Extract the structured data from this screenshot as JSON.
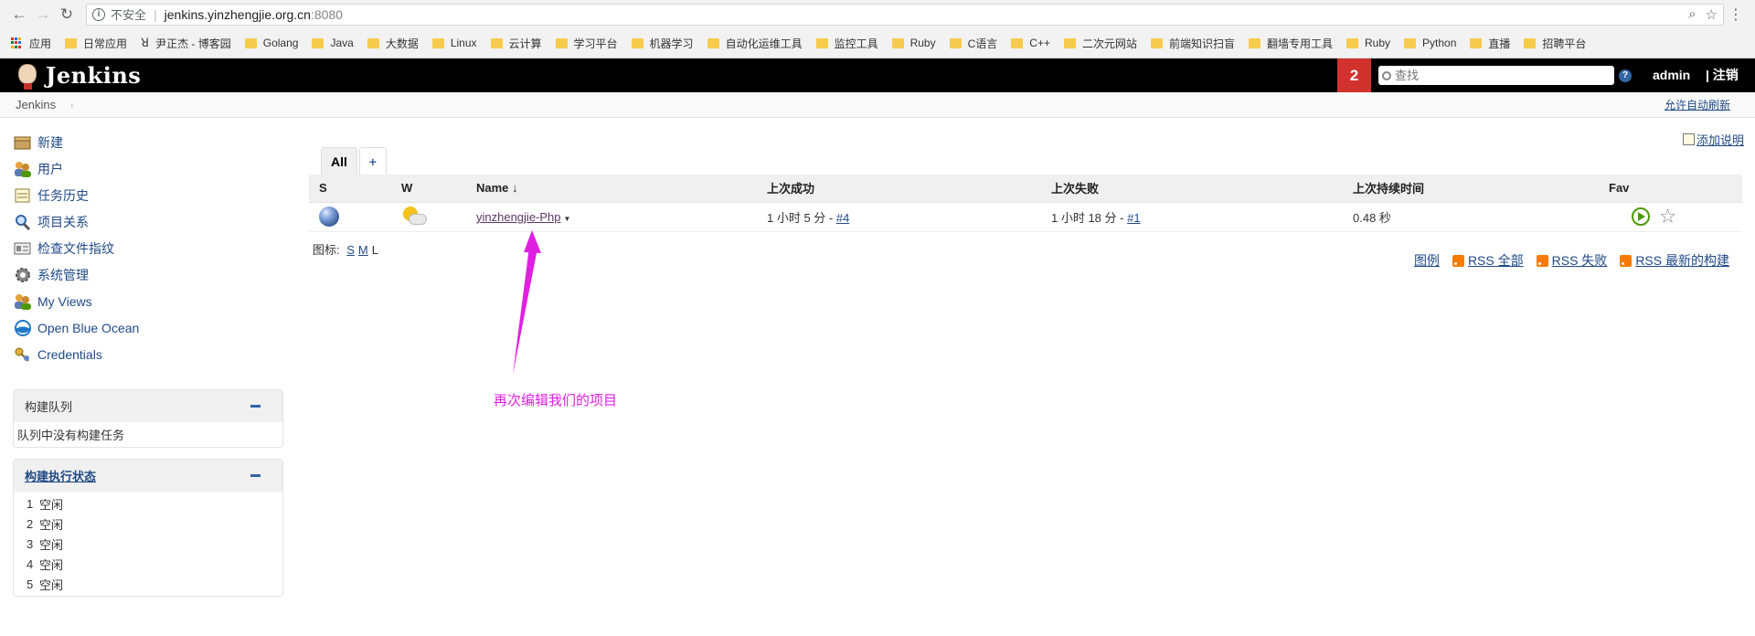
{
  "browser": {
    "insecure_label": "不安全",
    "host": "jenkins.yinzhengjie.org.cn",
    "port": ":8080",
    "bookmarks": [
      "应用",
      "日常应用",
      "尹正杰 - 博客园",
      "Golang",
      "Java",
      "大数据",
      "Linux",
      "云计算",
      "学习平台",
      "机器学习",
      "自动化运维工具",
      "监控工具",
      "Ruby",
      "C语言",
      "C++",
      "二次元网站",
      "前端知识扫盲",
      "翻墙专用工具",
      "Ruby",
      "Python",
      "直播",
      "招聘平台"
    ]
  },
  "header": {
    "logo_text": "Jenkins",
    "notification_count": "2",
    "search_placeholder": "查找",
    "help": "?",
    "user": "admin",
    "logout": "| 注销"
  },
  "breadcrumb": {
    "root": "Jenkins",
    "arrow": "›",
    "auto_refresh": "允许自动刷新"
  },
  "tasks": [
    {
      "label": "新建",
      "icon": "new-item-icon"
    },
    {
      "label": "用户",
      "icon": "users-icon"
    },
    {
      "label": "任务历史",
      "icon": "build-history-icon"
    },
    {
      "label": "项目关系",
      "icon": "project-relationship-icon"
    },
    {
      "label": "检查文件指纹",
      "icon": "fingerprint-icon"
    },
    {
      "label": "系统管理",
      "icon": "manage-jenkins-icon"
    },
    {
      "label": "My Views",
      "icon": "my-views-icon"
    },
    {
      "label": "Open Blue Ocean",
      "icon": "blue-ocean-icon"
    },
    {
      "label": "Credentials",
      "icon": "credentials-icon"
    }
  ],
  "build_queue": {
    "title": "构建队列",
    "empty": "队列中没有构建任务"
  },
  "executors": {
    "title": "构建执行状态",
    "rows": [
      {
        "n": "1",
        "status": "空闲"
      },
      {
        "n": "2",
        "status": "空闲"
      },
      {
        "n": "3",
        "status": "空闲"
      },
      {
        "n": "4",
        "status": "空闲"
      },
      {
        "n": "5",
        "status": "空闲"
      }
    ]
  },
  "main": {
    "add_description": "添加说明",
    "tabs": {
      "all": "All",
      "add": "+"
    },
    "columns": {
      "s": "S",
      "w": "W",
      "name": "Name ↓",
      "last_success": "上次成功",
      "last_failure": "上次失败",
      "last_duration": "上次持续时间",
      "fav": "Fav"
    },
    "job": {
      "name": "yinzhengjie-Php",
      "last_success_text": "1 小时 5 分 - ",
      "last_success_build": "#4",
      "last_failure_text": "1 小时 18 分 - ",
      "last_failure_build": "#1",
      "duration": "0.48 秒"
    },
    "icon_label": "图标:",
    "sizes": [
      "S",
      "M",
      "L"
    ],
    "legend": "图例",
    "rss_all": "RSS 全部",
    "rss_failed": "RSS 失败",
    "rss_latest": "RSS 最新的构建"
  },
  "annotation": {
    "text": "再次编辑我们的项目",
    "color": "#e020e0"
  }
}
